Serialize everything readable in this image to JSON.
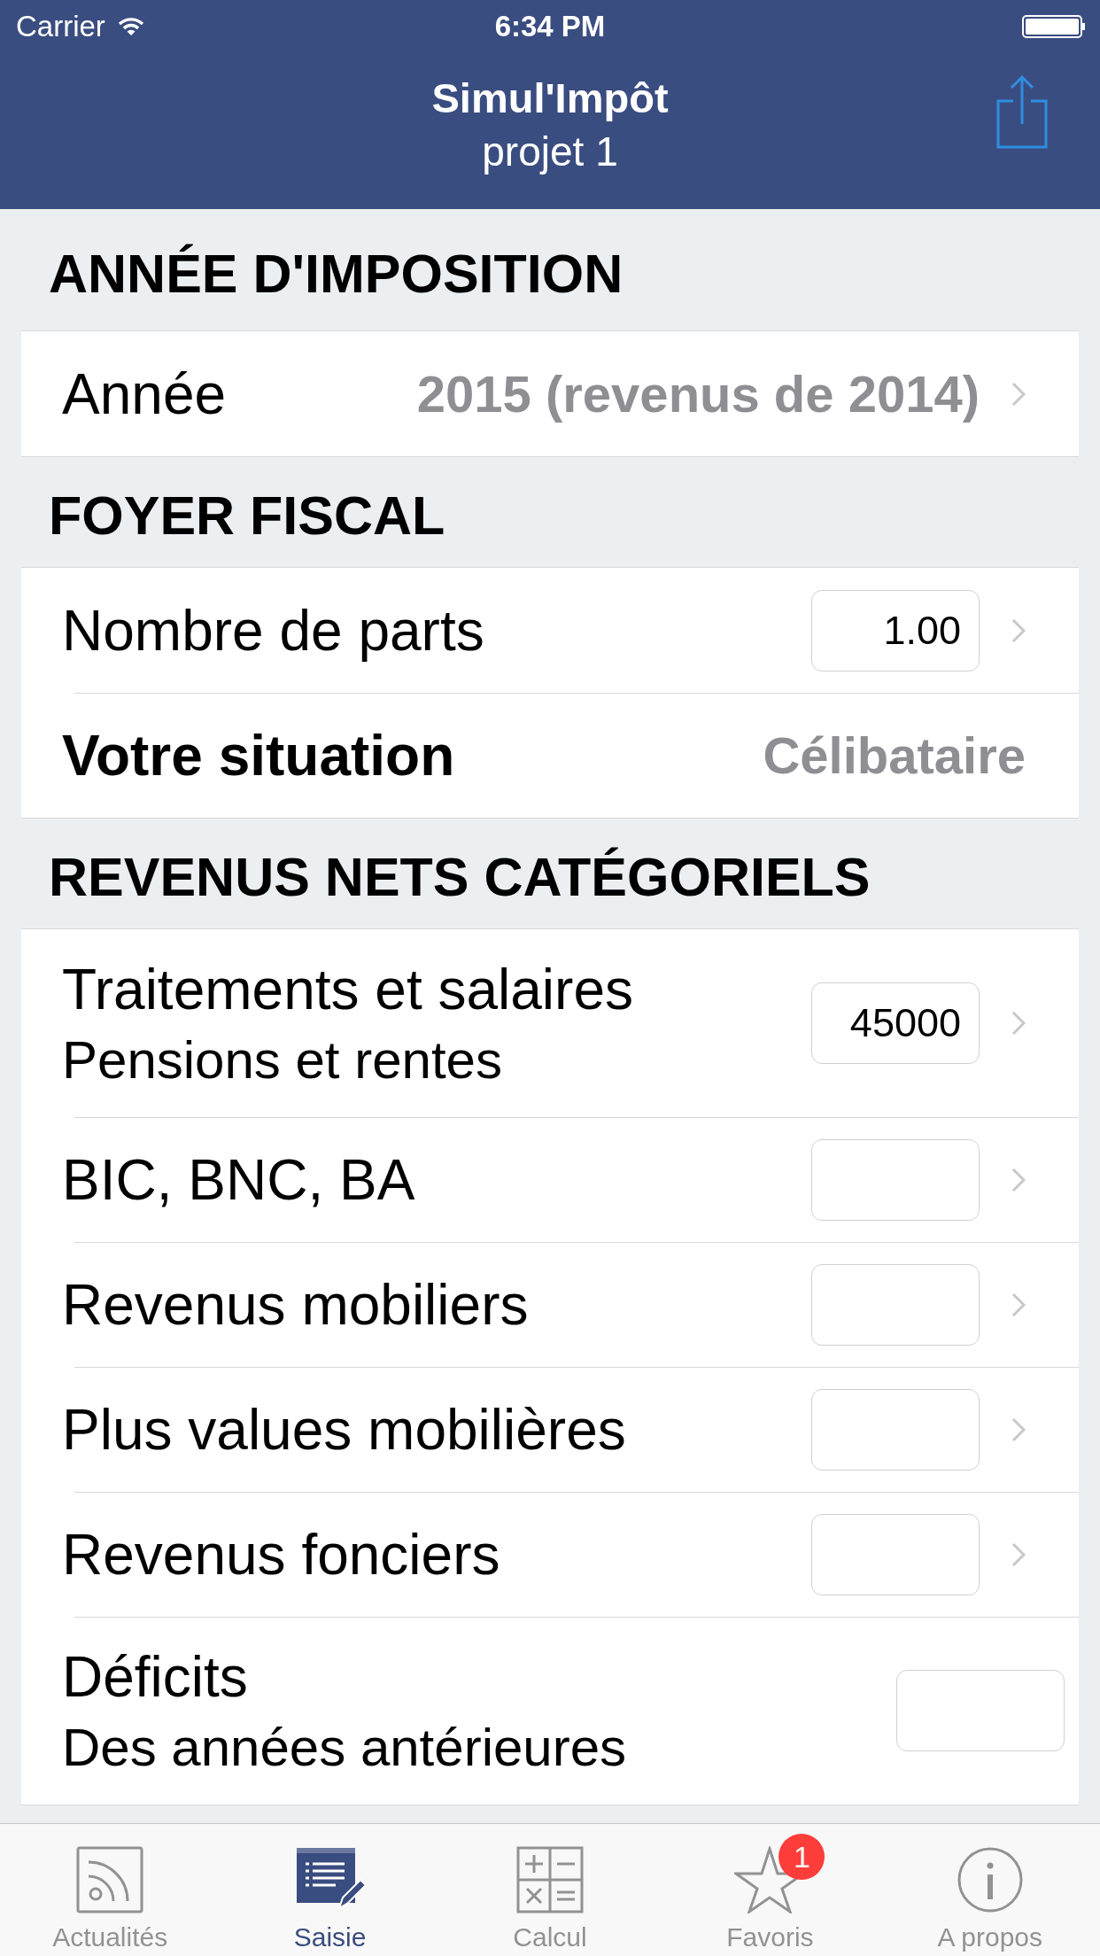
{
  "status_bar": {
    "carrier": "Carrier",
    "time": "6:34 PM"
  },
  "nav": {
    "title": "Simul'Impôt",
    "subtitle": "projet 1"
  },
  "sections": [
    {
      "title": "ANNÉE D'IMPOSITION",
      "rows": [
        {
          "kind": "select",
          "label": "Année",
          "value": "2015 (revenus de 2014)",
          "bold": false,
          "chevron": true
        }
      ]
    },
    {
      "title": "FOYER FISCAL",
      "rows": [
        {
          "kind": "input",
          "label": "Nombre de parts",
          "value": "1.00",
          "bold": false,
          "chevron": true
        },
        {
          "kind": "static",
          "label": "Votre situation",
          "value": "Célibataire",
          "bold": true,
          "chevron": false
        }
      ]
    },
    {
      "title": "REVENUS NETS CATÉGORIELS",
      "rows": [
        {
          "kind": "input",
          "label": "Traitements et salaires",
          "sublabel": "Pensions et rentes",
          "value": "45000",
          "bold": false,
          "chevron": true
        },
        {
          "kind": "input",
          "label": "BIC, BNC, BA",
          "bold": false,
          "chevron": true
        },
        {
          "kind": "input",
          "label": "Revenus mobiliers",
          "bold": false,
          "chevron": true
        },
        {
          "kind": "input",
          "label": "Plus values mobilières",
          "bold": false,
          "chevron": true
        },
        {
          "kind": "input",
          "label": "Revenus fonciers",
          "bold": false,
          "chevron": true
        },
        {
          "kind": "input",
          "label": "Déficits",
          "sublabel": "Des années antérieures",
          "bold": false,
          "chevron": false
        }
      ]
    }
  ],
  "tabs": [
    {
      "label": "Actualités",
      "selected": false
    },
    {
      "label": "Saisie",
      "selected": true
    },
    {
      "label": "Calcul",
      "selected": false
    },
    {
      "label": "Favoris",
      "selected": false,
      "badge": "1"
    },
    {
      "label": "A propos",
      "selected": false
    }
  ]
}
